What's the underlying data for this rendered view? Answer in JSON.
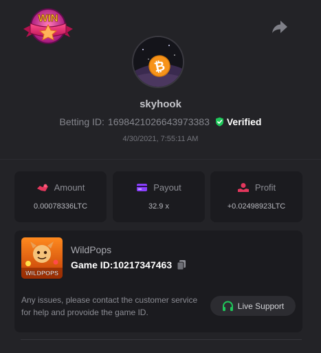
{
  "header": {
    "badge_text": "WIN",
    "share_icon": "share-arrow-icon"
  },
  "profile": {
    "avatar_icon": "bitcoin-icon",
    "username": "skyhook",
    "betting_label": "Betting ID:",
    "betting_id": "1698421026643973383",
    "verified_label": "Verified",
    "timestamp": "4/30/2021, 7:55:11 AM"
  },
  "stats": [
    {
      "label": "Amount",
      "value": "0.00078336LTC",
      "icon": "amount-icon",
      "color": "#e4375d"
    },
    {
      "label": "Payout",
      "value": "32.9 x",
      "icon": "payout-icon",
      "color": "#8a3ffc"
    },
    {
      "label": "Profit",
      "value": "+0.02498923LTC",
      "icon": "profit-icon",
      "color": "#e4375d"
    }
  ],
  "game": {
    "name": "WildPops",
    "thumb_text": "WILDPOPS",
    "id_label": "Game ID:",
    "id": "10217347463",
    "help_text": "Any issues, please contact the customer service for help and provoide the game ID.",
    "support_label": "Live Support"
  },
  "colors": {
    "background": "#232327",
    "card": "#1b1b1f",
    "verified_green": "#1fc75a",
    "support_green": "#1fc75a"
  }
}
